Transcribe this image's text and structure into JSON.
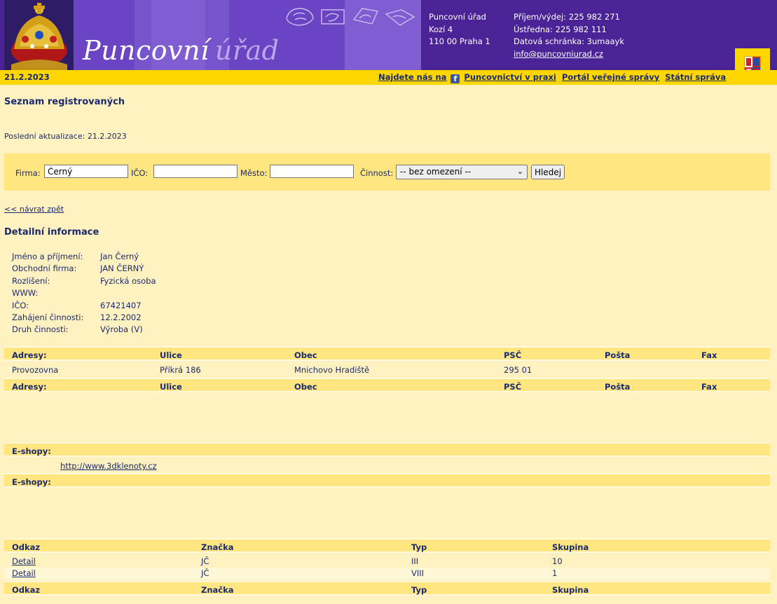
{
  "header": {
    "logo_part1": "Puncovní",
    "logo_part2": "úřad",
    "address": [
      "Puncovní úřad",
      "Kozí 4",
      "110 00 Praha 1"
    ],
    "phone": "Příjem/výdej: 225 982 271",
    "switchboard": "Ústředna: 225 982 111",
    "databox": "Datová schránka: 3umaayk",
    "email": "info@puncovniurad.cz"
  },
  "navbar": {
    "date": "21.2.2023",
    "find_us": "Najdete nás na",
    "link1": "Puncovnictví v praxi",
    "link2": "Portál veřejné správy",
    "link3": "Státní správa"
  },
  "page": {
    "title": "Seznam registrovaných",
    "updated": "Poslední aktualizace: 21.2.2023",
    "back_link": "<< návrat zpět",
    "detail_title": "Detailní informace"
  },
  "search": {
    "firma_label": "Firma:",
    "firma_value": "Černý",
    "ico_label": "IČO:",
    "ico_value": "",
    "mesto_label": "Město:",
    "mesto_value": "",
    "cinnost_label": "Činnost:",
    "cinnost_selected": "-- bez omezení --",
    "button": "Hledej"
  },
  "details": [
    {
      "label": "Jméno a příjmení:",
      "value": "Jan Černý"
    },
    {
      "label": "Obchodní firma:",
      "value": "JAN ČERNÝ"
    },
    {
      "label": "Rozlišení:",
      "value": "Fyzická osoba"
    },
    {
      "label": "WWW:",
      "value": ""
    },
    {
      "label": "IČO:",
      "value": "67421407"
    },
    {
      "label": "Zahájení činnosti:",
      "value": "12.2.2002"
    },
    {
      "label": "Druh činnosti:",
      "value": "Výroba (V)"
    }
  ],
  "addresses": {
    "headers": [
      "Adresy:",
      "Ulice",
      "Obec",
      "PSČ",
      "Pošta",
      "Fax"
    ],
    "rows": [
      [
        "Provozovna",
        "Příkrá 186",
        "Mnichovo Hradiště",
        "295 01",
        "",
        ""
      ]
    ]
  },
  "eshops": {
    "header": "E-shopy:",
    "links": [
      "http://www.3dklenoty.cz"
    ]
  },
  "marks": {
    "headers": [
      "Odkaz",
      "Značka",
      "Typ",
      "Skupina"
    ],
    "rows": [
      [
        "Detail",
        "JČ",
        "III",
        "10"
      ],
      [
        "Detail",
        "JČ",
        "VIII",
        "1"
      ]
    ]
  }
}
